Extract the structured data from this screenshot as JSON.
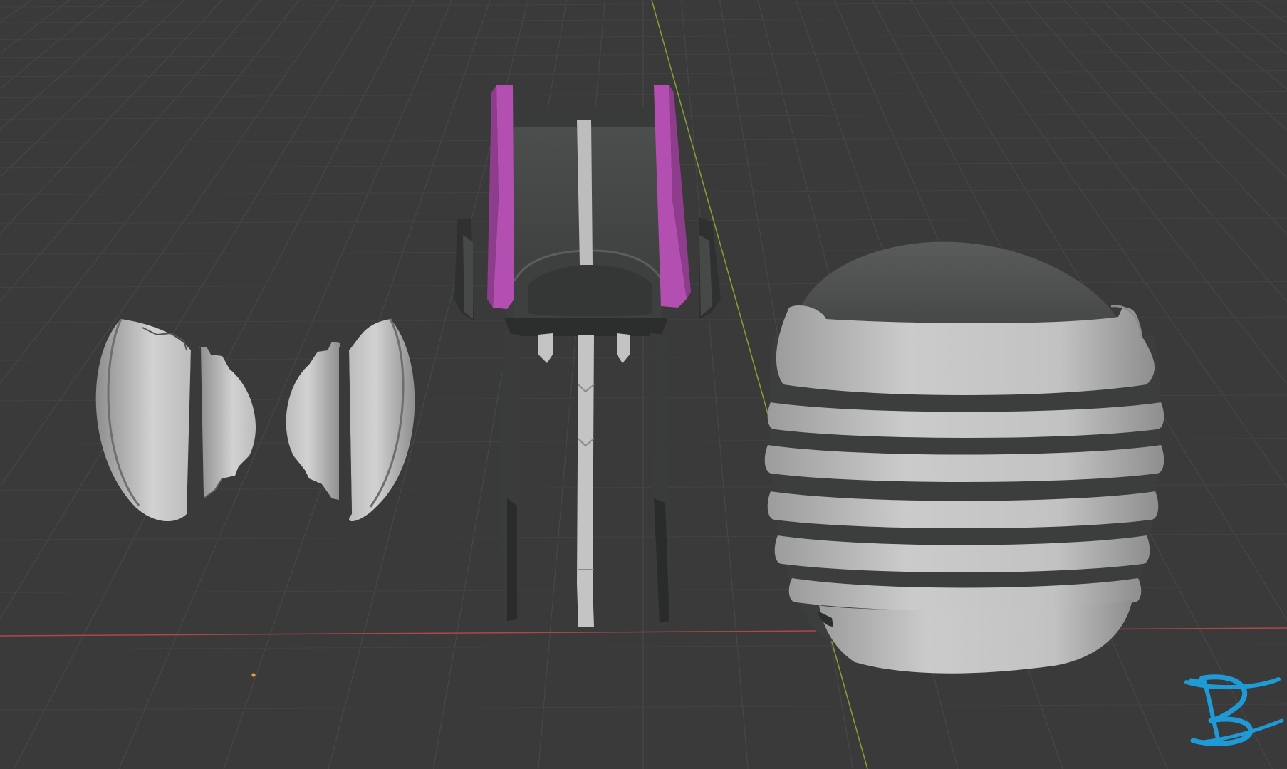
{
  "viewport": {
    "view": "3d-viewport",
    "background_color": "#3a3a3a",
    "grid_color": "#474747",
    "x_axis_color": "#b04646",
    "y_axis_color": "#8aa032",
    "origin_color": "#f0a030"
  },
  "objects": [
    {
      "name": "left-ear-piece",
      "shade": "light-gray"
    },
    {
      "name": "right-ear-piece",
      "shade": "light-gray"
    },
    {
      "name": "faceplate",
      "shade": "dark-gray",
      "accent_color": "#b24fb0"
    },
    {
      "name": "helmet-dome",
      "shade": "dark-gray",
      "band_color": "#c4c4c4"
    }
  ],
  "watermark": {
    "icon": "logo-icon",
    "color": "#1e9ad6"
  }
}
